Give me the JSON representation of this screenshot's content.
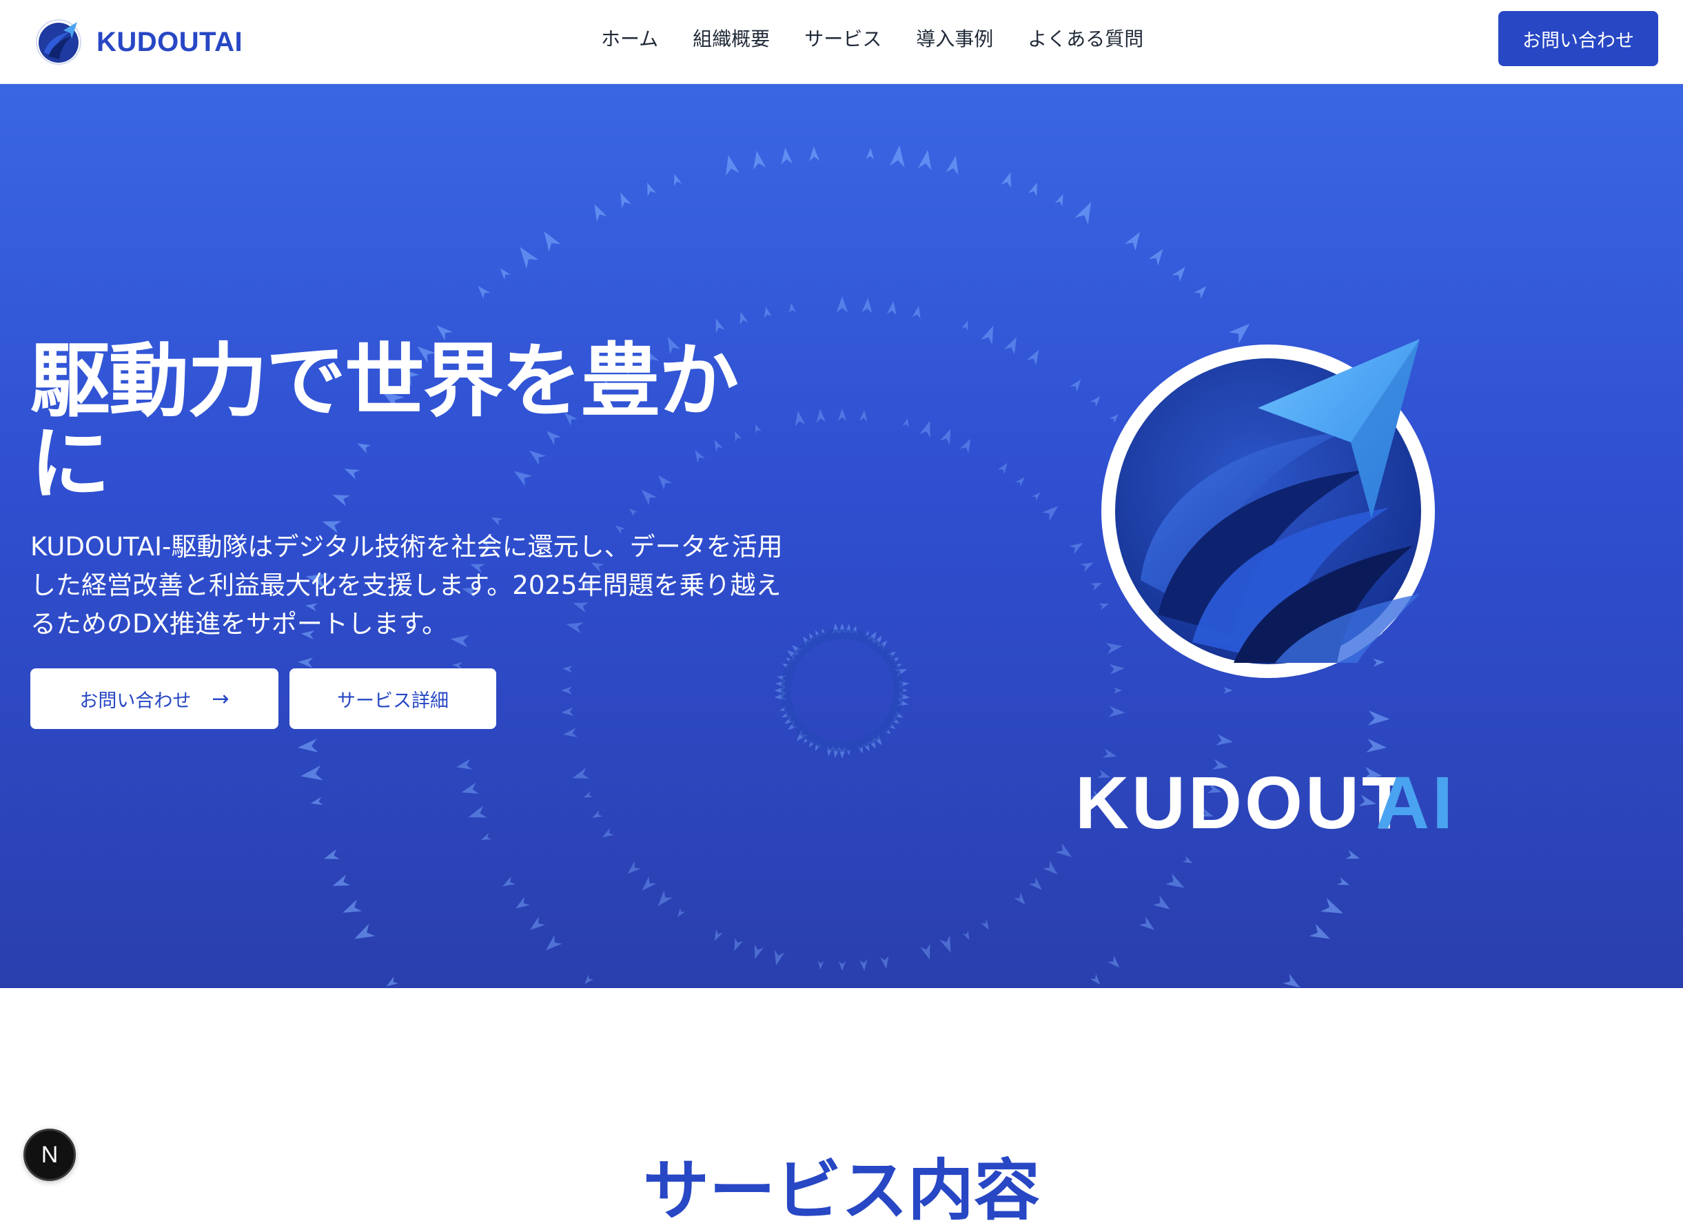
{
  "header": {
    "brand": "KUDOUTAI",
    "nav": [
      "ホーム",
      "組織概要",
      "サービス",
      "導入事例",
      "よくある質問"
    ],
    "cta": "お問い合わせ"
  },
  "hero": {
    "title": "駆動力で世界を豊かに",
    "description": "KUDOUTAI-駆動隊はデジタル技術を社会に還元し、データを活用した経営改善と利益最大化を支援します。2025年問題を乗り越えるためのDX推進をサポートします。",
    "primary_button": "お問い合わせ",
    "primary_icon": "arrow-right-icon",
    "secondary_button": "サービス詳細",
    "logo_text_main": "KUDOUT",
    "logo_text_accent": "AI"
  },
  "section": {
    "title": "サービス内容"
  },
  "badge": {
    "letter": "N"
  },
  "colors": {
    "brand": "#2747c4",
    "hero_top": "#3a66e3",
    "hero_bottom": "#2a3fae",
    "logo_accent": "#4aa3f0"
  }
}
